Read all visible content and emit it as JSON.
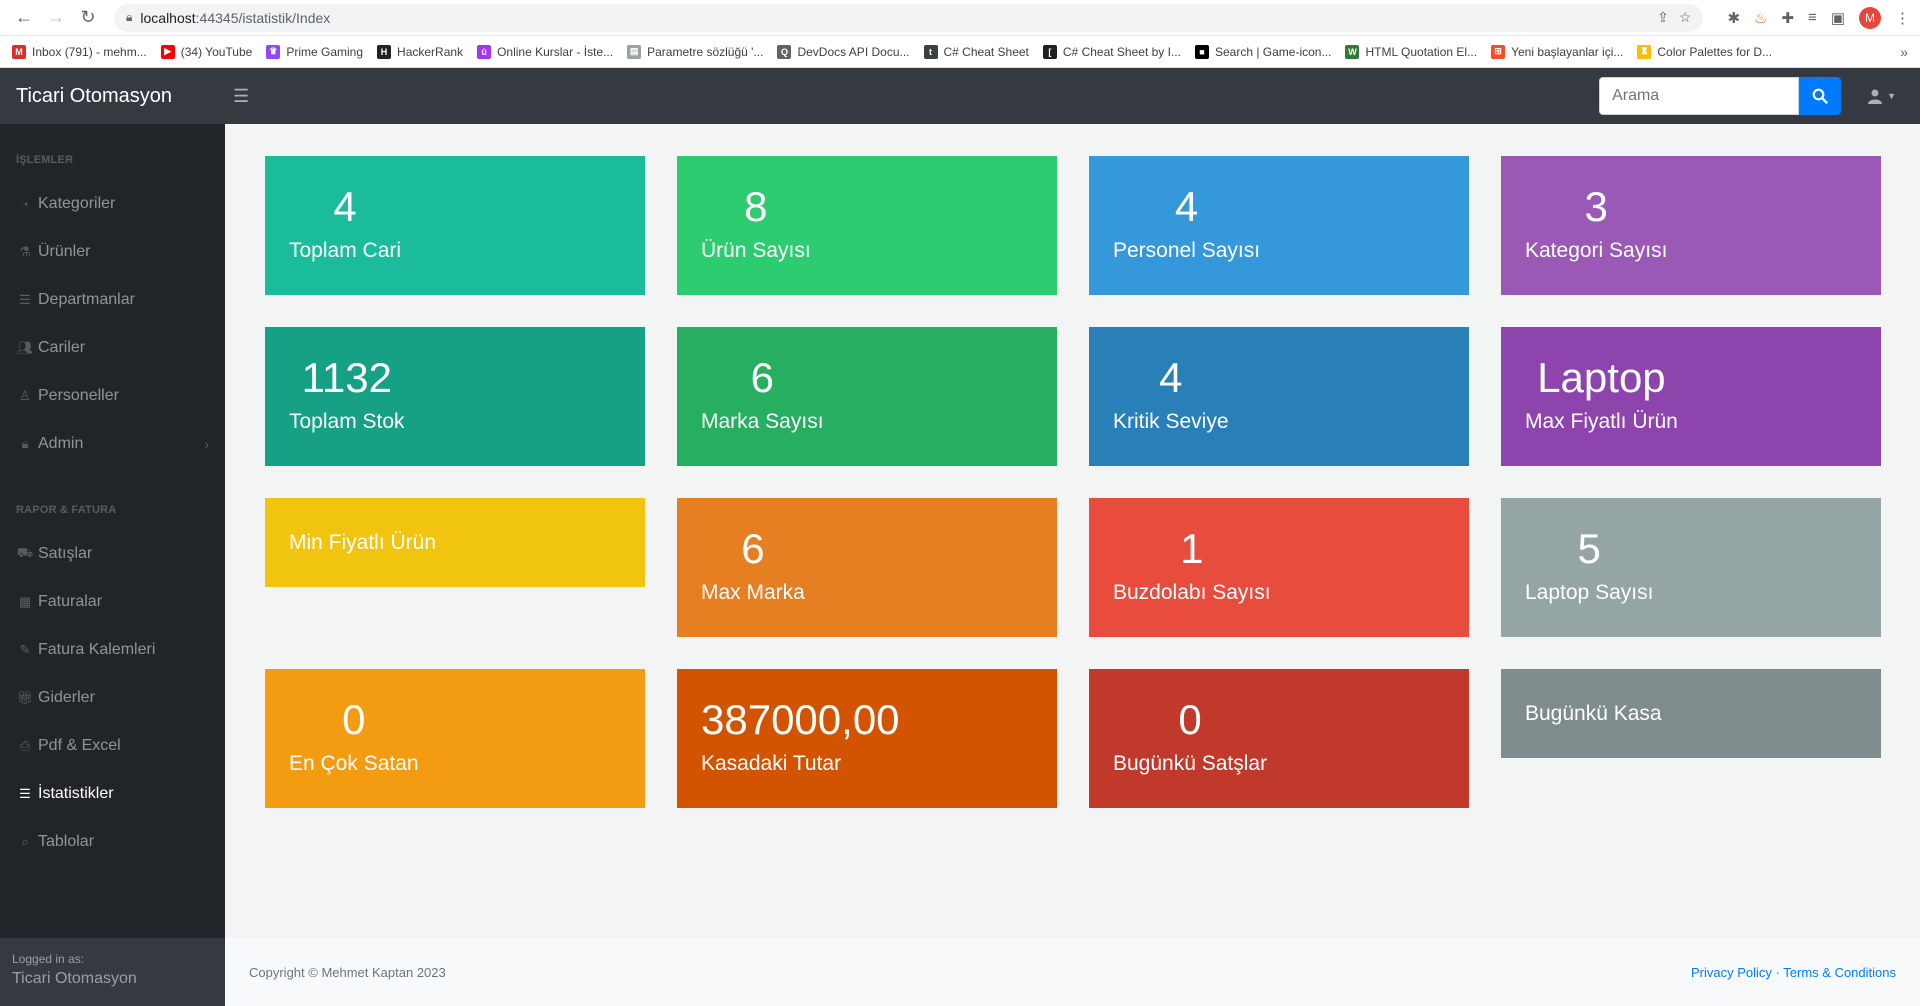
{
  "browser": {
    "url_host": "localhost",
    "url_rest": ":44345/istatistik/Index",
    "profile_initial": "M"
  },
  "bookmarks": [
    {
      "label": "Inbox (791) - mehm...",
      "color": "#d93025",
      "glyph": "M"
    },
    {
      "label": "(34) YouTube",
      "color": "#ff0000",
      "glyph": "▶"
    },
    {
      "label": "Prime Gaming",
      "color": "#9146ff",
      "glyph": "♛"
    },
    {
      "label": "HackerRank",
      "color": "#1f2228",
      "glyph": "H"
    },
    {
      "label": "Online Kurslar - İste...",
      "color": "#a435f0",
      "glyph": "û"
    },
    {
      "label": "Parametre sözlüğü '...",
      "color": "#9aa0a6",
      "glyph": "▤"
    },
    {
      "label": "DevDocs API Docu...",
      "color": "#5f6368",
      "glyph": "Q"
    },
    {
      "label": "C# Cheat Sheet",
      "color": "#3c4043",
      "glyph": "t"
    },
    {
      "label": "C# Cheat Sheet by I...",
      "color": "#202124",
      "glyph": "["
    },
    {
      "label": "Search | Game-icon...",
      "color": "#000000",
      "glyph": "■"
    },
    {
      "label": "HTML Quotation El...",
      "color": "#2e7d32",
      "glyph": "W"
    },
    {
      "label": "Yeni başlayanlar içi...",
      "color": "#f25022",
      "glyph": "⊞"
    },
    {
      "label": "Color Palettes for D...",
      "color": "#fbbc04",
      "glyph": "♜"
    }
  ],
  "app": {
    "brand": "Ticari Otomasyon",
    "search_placeholder": "Arama"
  },
  "sidebar": {
    "heading1": "İŞLEMLER",
    "heading2": "RAPOR & FATURA",
    "items1": [
      {
        "label": "Kategoriler",
        "icon": "dashboard-icon"
      },
      {
        "label": "Ürünler",
        "icon": "flask-icon"
      },
      {
        "label": "Departmanlar",
        "icon": "bars-icon"
      },
      {
        "label": "Cariler",
        "icon": "users-icon"
      },
      {
        "label": "Personeller",
        "icon": "user-tie-icon"
      },
      {
        "label": "Admin",
        "icon": "lock-icon"
      }
    ],
    "items2": [
      {
        "label": "Satışlar",
        "icon": "car-icon"
      },
      {
        "label": "Faturalar",
        "icon": "calendar-icon"
      },
      {
        "label": "Fatura Kalemleri",
        "icon": "pencil-icon"
      },
      {
        "label": "Giderler",
        "icon": "gift-icon"
      },
      {
        "label": "Pdf & Excel",
        "icon": "print-icon"
      },
      {
        "label": "İstatistikler",
        "icon": "database-icon"
      },
      {
        "label": "Tablolar",
        "icon": "search-icon"
      }
    ],
    "footer_small": "Logged in as:",
    "footer_big": "Ticari Otomasyon"
  },
  "cards": [
    {
      "value": "4",
      "label": "Toplam Cari",
      "color": "#1abc9c"
    },
    {
      "value": "8",
      "label": "Ürün Sayısı",
      "color": "#2ecc71"
    },
    {
      "value": "4",
      "label": "Personel Sayısı",
      "color": "#3498db"
    },
    {
      "value": "3",
      "label": "Kategori Sayısı",
      "color": "#9b59b6"
    },
    {
      "value": "1132",
      "label": "Toplam Stok",
      "color": "#16a085"
    },
    {
      "value": "6",
      "label": "Marka Sayısı",
      "color": "#27ae60"
    },
    {
      "value": "4",
      "label": "Kritik Seviye",
      "color": "#2980b9"
    },
    {
      "value": "Laptop",
      "label": "Max Fiyatlı Ürün",
      "color": "#8e44ad"
    },
    {
      "value": "",
      "label": "Min Fiyatlı Ürün",
      "color": "#f1c40f"
    },
    {
      "value": "6",
      "label": "Max Marka",
      "color": "#e67e22"
    },
    {
      "value": "1",
      "label": "Buzdolabı Sayısı",
      "color": "#e74c3c"
    },
    {
      "value": "5",
      "label": "Laptop Sayısı",
      "color": "#95a5a6"
    },
    {
      "value": "0",
      "label": "En Çok Satan",
      "color": "#f39c12"
    },
    {
      "value": "387000,00",
      "label": "Kasadaki Tutar",
      "color": "#d35400"
    },
    {
      "value": "0",
      "label": "Bugünkü Satşlar",
      "color": "#c0392b"
    },
    {
      "value": "",
      "label": "Bugünkü Kasa",
      "color": "#7f8c8d"
    }
  ],
  "footer": {
    "copyright": "Copyright © Mehmet Kaptan 2023",
    "privacy": "Privacy Policy",
    "separator": "·",
    "terms": "Terms & Conditions"
  }
}
